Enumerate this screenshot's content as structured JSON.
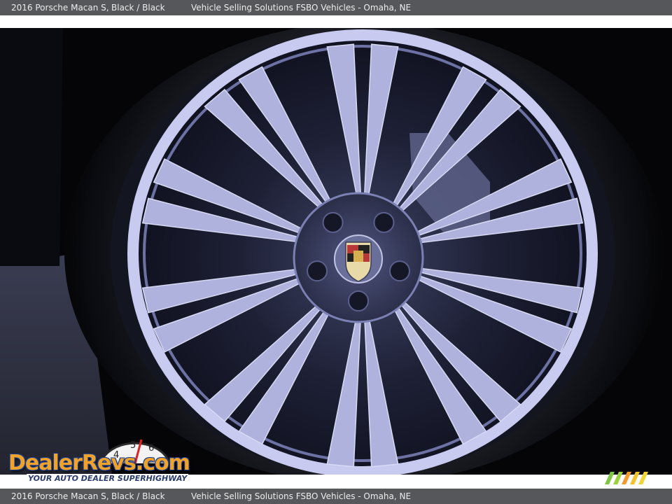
{
  "caption": {
    "vehicle": "2016 Porsche Macan S,",
    "colors": "Black  / Black",
    "seller": "Vehicle Selling Solutions FSBO Vehicles - Omaha, NE"
  },
  "watermark": {
    "logo": "DealerRevs.com",
    "tagline": "YOUR AUTO DEALER SUPERHIGHWAY",
    "gauge_digits": [
      "4",
      "5",
      "6"
    ]
  },
  "photo": {
    "subject-icon": "alloy-wheel-icon",
    "badge-icon": "porsche-crest-icon"
  },
  "colors": {
    "bar": "#55575b",
    "bar_text": "#ececec",
    "rim": "#b9bde6",
    "logo_orange": "#f0a22a",
    "logo_blue": "#1a3f8f"
  }
}
